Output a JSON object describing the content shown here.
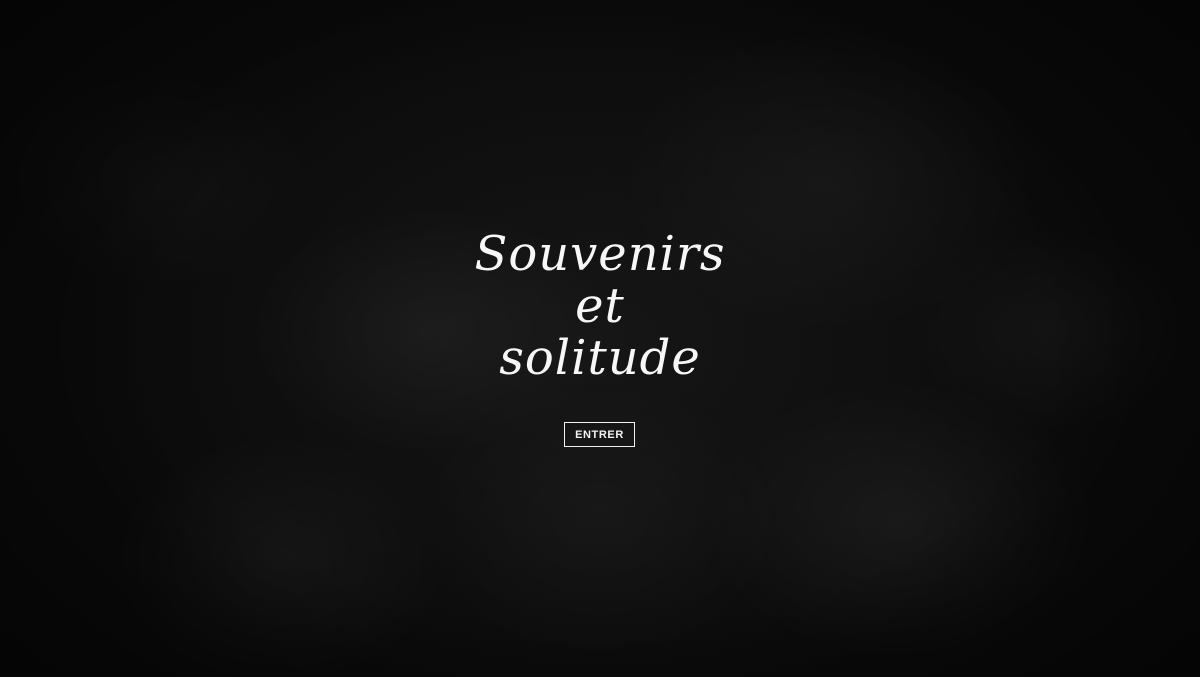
{
  "title": {
    "line1": "Souvenirs",
    "line2": "et",
    "line3": "solitude"
  },
  "enter_button": {
    "label": "ENTRER"
  },
  "colors": {
    "background": "#0b0b0b",
    "text": "#f7f7f7"
  }
}
